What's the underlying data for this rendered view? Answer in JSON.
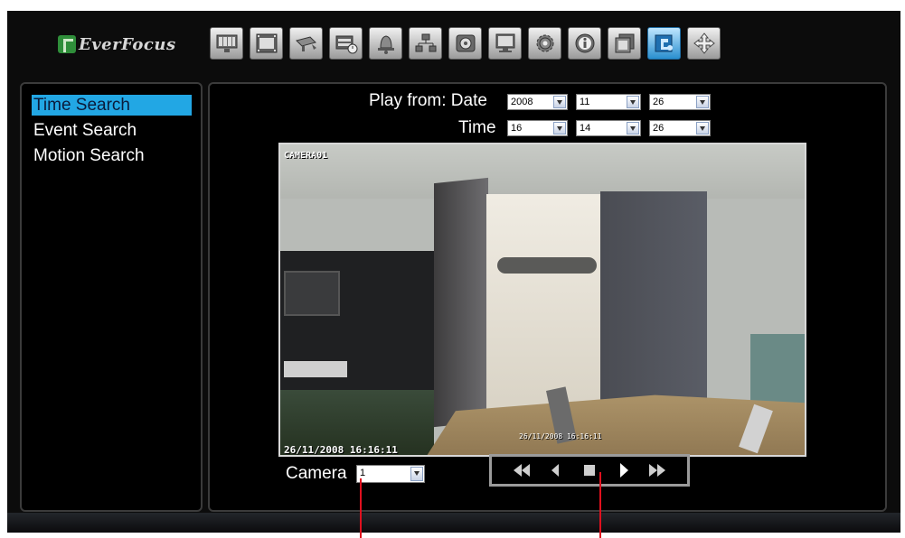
{
  "brand": {
    "logo_text": "EverFocus"
  },
  "toolbar": {
    "icons": [
      "live-view-icon",
      "playback-icon",
      "camera-icon",
      "record-schedule-icon",
      "alarm-bell-icon",
      "network-icon",
      "disk-icon",
      "display-monitor-icon",
      "settings-gear-icon",
      "info-icon",
      "film-icon",
      "search-icon",
      "move-arrows-icon"
    ],
    "active_index": 11
  },
  "sidebar": {
    "items": [
      {
        "label": "Time Search",
        "selected": true
      },
      {
        "label": "Event Search",
        "selected": false
      },
      {
        "label": "Motion Search",
        "selected": false
      }
    ]
  },
  "search": {
    "play_from_label": "Play from: Date",
    "time_label": "Time",
    "date": {
      "year": "2008",
      "month": "11",
      "day": "26"
    },
    "time": {
      "hour": "16",
      "minute": "14",
      "second": "26"
    }
  },
  "video": {
    "camera_title": "CAMERA01",
    "timestamp": "26/11/2008  16:16:11",
    "inner_timestamp": "26/11/2008 16:16:11"
  },
  "camera_select": {
    "label": "Camera",
    "value": "1"
  },
  "playback": {
    "buttons": [
      "rewind-icon",
      "step-back-icon",
      "stop-icon",
      "play-icon",
      "fast-forward-icon"
    ]
  },
  "colors": {
    "selection": "#22a7e4",
    "annotation_line": "#e0101e",
    "active_toolbar": "#2a8fcf"
  }
}
